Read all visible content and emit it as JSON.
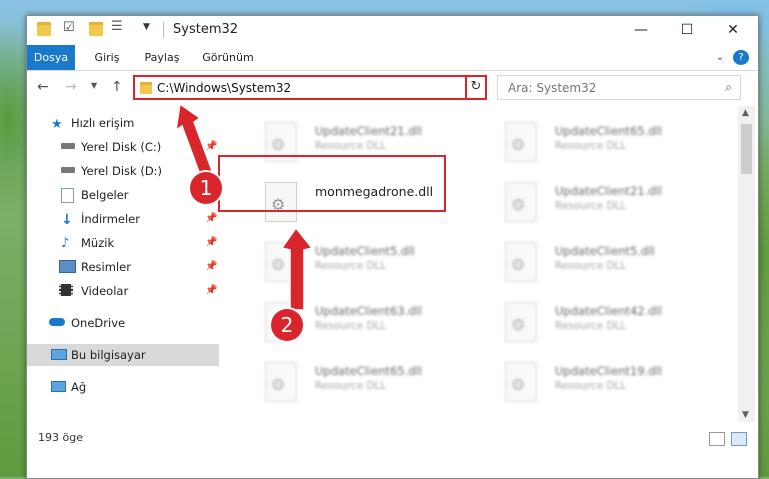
{
  "window": {
    "title": "System32",
    "controls": {
      "minimize": "—",
      "maximize": "☐",
      "close": "✕"
    }
  },
  "ribbon": {
    "tabs": [
      "Dosya",
      "Giriş",
      "Paylaş",
      "Görünüm"
    ],
    "active_tab": "Dosya",
    "help": "?"
  },
  "address": {
    "path": "C:\\Windows\\System32",
    "search_placeholder": "Ara: System32"
  },
  "sidebar": {
    "items": [
      {
        "label": "Hızlı erişim",
        "icon": "star-icon"
      },
      {
        "label": "Yerel Disk (C:)",
        "icon": "drive-icon",
        "pinned": true
      },
      {
        "label": "Yerel Disk (D:)",
        "icon": "drive-icon"
      },
      {
        "label": "Belgeler",
        "icon": "document-icon",
        "pinned": true
      },
      {
        "label": "İndirmeler",
        "icon": "download-icon",
        "pinned": true
      },
      {
        "label": "Müzik",
        "icon": "music-icon",
        "pinned": true
      },
      {
        "label": "Resimler",
        "icon": "picture-icon",
        "pinned": true
      },
      {
        "label": "Videolar",
        "icon": "video-icon",
        "pinned": true
      },
      {
        "label": "OneDrive",
        "icon": "cloud-icon"
      },
      {
        "label": "Bu bilgisayar",
        "icon": "computer-icon",
        "selected": true
      },
      {
        "label": "Ağ",
        "icon": "network-icon"
      }
    ]
  },
  "files": {
    "left_column": [
      {
        "name": "UpdateClient21.dll",
        "type": "Resource DLL"
      },
      {
        "name": "monmegadrone.dll",
        "type": "",
        "highlighted": true
      },
      {
        "name": "UpdateClient5.dll",
        "type": "Resource DLL"
      },
      {
        "name": "UpdateClient63.dll",
        "type": "Resource DLL"
      },
      {
        "name": "UpdateClient65.dll",
        "type": "Resource DLL"
      }
    ],
    "right_column": [
      {
        "name": "UpdateClient65.dll",
        "type": "Resource DLL"
      },
      {
        "name": "UpdateClient21.dll",
        "type": "Resource DLL"
      },
      {
        "name": "UpdateClient5.dll",
        "type": "Resource DLL"
      },
      {
        "name": "UpdateClient42.dll",
        "type": "Resource DLL"
      },
      {
        "name": "UpdateClient19.dll",
        "type": "Resource DLL"
      }
    ]
  },
  "status": {
    "count": "193 öge"
  },
  "callouts": {
    "one": "1",
    "two": "2"
  },
  "colors": {
    "accent": "#1979ca",
    "annotation": "#d8262c"
  }
}
